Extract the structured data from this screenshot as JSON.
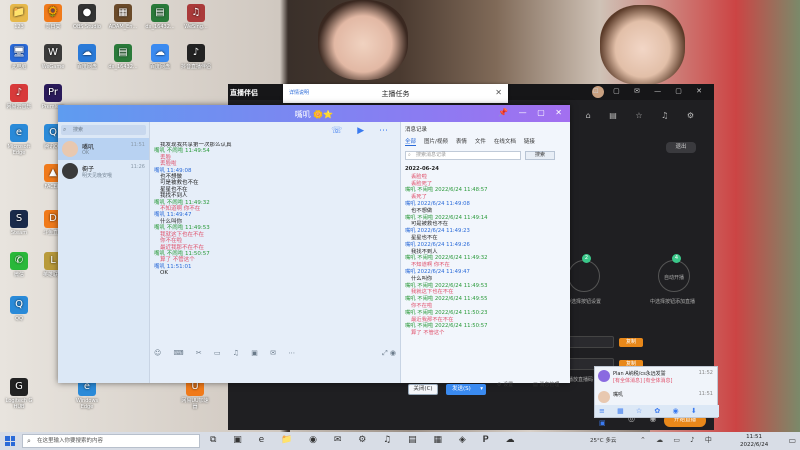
{
  "desktop": {
    "icons": [
      {
        "label": "123",
        "glyph": "📁",
        "color": "#e6b84a"
      },
      {
        "label": "向日葵",
        "glyph": "🌻",
        "color": "#f07a1a"
      },
      {
        "label": "OBS Studio",
        "glyph": "●",
        "color": "#333"
      },
      {
        "label": "ADAM_En...",
        "glyph": "▦",
        "color": "#6a4a2a"
      },
      {
        "label": "dx_16432...",
        "glyph": "▤",
        "color": "#2a7a3a"
      },
      {
        "label": "WeSing...",
        "glyph": "♫",
        "color": "#aa3a3a"
      },
      {
        "label": "此电脑",
        "glyph": "🖥",
        "color": "#2a6ad8"
      },
      {
        "label": "WeGame",
        "glyph": "W",
        "color": "#3a3a3a"
      },
      {
        "label": "百度网盘",
        "glyph": "☁",
        "color": "#2a7ad8"
      },
      {
        "label": "dx_16432...",
        "glyph": "▤",
        "color": "#2a7a3a"
      },
      {
        "label": "百度网盘",
        "glyph": "☁",
        "color": "#3a8af0"
      },
      {
        "label": "抖音直播伴侣",
        "glyph": "♪",
        "color": "#222"
      },
      {
        "label": "Premiere",
        "glyph": "Pr",
        "color": "#2a1a5a"
      },
      {
        "label": "网易云音乐",
        "glyph": "♪",
        "color": "#d83a3a"
      },
      {
        "label": "Microsoft Edge",
        "glyph": "e",
        "color": "#2a8ad8"
      },
      {
        "label": "腾讯QQ",
        "glyph": "Q",
        "color": "#2a8ad8"
      },
      {
        "label": "FACEIT",
        "glyph": "▲",
        "color": "#f07a1a"
      },
      {
        "label": "Steam",
        "glyph": "S",
        "color": "#1a2a4a"
      },
      {
        "label": "斗鱼直播",
        "glyph": "D",
        "color": "#f07a1a"
      },
      {
        "label": "微信",
        "glyph": "✆",
        "color": "#2ab83a"
      },
      {
        "label": "英雄联盟",
        "glyph": "L",
        "color": "#b89a3a"
      },
      {
        "label": "QQ",
        "glyph": "Q",
        "color": "#2a8ad8"
      },
      {
        "label": "Logitech G HUB",
        "glyph": "G",
        "color": "#222"
      },
      {
        "label": "Windows Edge",
        "glyph": "e",
        "color": "#2a8ad8"
      },
      {
        "label": "网易UU加速器",
        "glyph": "U",
        "color": "#f07a1a"
      }
    ]
  },
  "chat_window": {
    "title": "嘴叽 🌼⭐",
    "search_placeholder": "搜索",
    "contacts": [
      {
        "name": "嘴叽",
        "preview": "OK",
        "time": "11:51",
        "avatar_color": "#e8c8b0"
      },
      {
        "name": "橱子",
        "preview": "明天见晚安哦",
        "time": "11:26",
        "avatar_color": "#3a3a3a"
      }
    ],
    "messages": [
      {
        "kind": "t",
        "text": "我发现我共享第一次那么认真"
      },
      {
        "kind": "h-g",
        "text": "嘴叽 不闹啦 11:49:54"
      },
      {
        "kind": "t-r",
        "text": "丢脸"
      },
      {
        "kind": "t-r",
        "text": "丢脸啦"
      },
      {
        "kind": "h-b",
        "text": "嘴叽 11:49:08"
      },
      {
        "kind": "t",
        "text": "也不想做"
      },
      {
        "kind": "t",
        "text": "可是被救也不在"
      },
      {
        "kind": "t",
        "text": "星星也不在"
      },
      {
        "kind": "t",
        "text": "我找不到人"
      },
      {
        "kind": "h-g",
        "text": "嘴叽 不闹啦 11:49:32"
      },
      {
        "kind": "t-r",
        "text": "不知道啊 你不在"
      },
      {
        "kind": "h-b",
        "text": "嘴叽 11:49:47"
      },
      {
        "kind": "t",
        "text": "什么叫你"
      },
      {
        "kind": "h-g",
        "text": "嘴叽 不闹啦 11:49:53"
      },
      {
        "kind": "t-r",
        "text": "我就这下也在不在"
      },
      {
        "kind": "t-r",
        "text": "你不在啦"
      },
      {
        "kind": "t-r",
        "text": "最近我那不在不在"
      },
      {
        "kind": "h-g",
        "text": "嘴叽 不闹啦 11:50:57"
      },
      {
        "kind": "t-r",
        "text": "算了 不管这个"
      },
      {
        "kind": "h-b",
        "text": "嘴叽 11:51:01"
      },
      {
        "kind": "t",
        "text": "OK"
      }
    ],
    "toolbar_icons": "☺ ⌨ ✂ ▭ ♫ ▣ ✉ ⋯",
    "close_label": "关闭(C)",
    "send_label": "发送(S)",
    "record": {
      "title": "消息记录",
      "tabs": [
        "全部",
        "图片/视频",
        "表情",
        "文件",
        "在线文档",
        "链接"
      ],
      "search_placeholder": "搜索消息记录",
      "search_button": "搜索",
      "date": "2022-06-24",
      "messages": [
        {
          "kind": "t-r",
          "text": "丢脸啦"
        },
        {
          "kind": "t-r",
          "text": "丢脸死了"
        },
        {
          "kind": "h-g",
          "text": "嘴叽 不闹啦 2022/6/24 11:48:57"
        },
        {
          "kind": "t-r",
          "text": "丢死了"
        },
        {
          "kind": "h-b",
          "text": "嘴叽 2022/6/24 11:49:08"
        },
        {
          "kind": "t",
          "text": "也不想做"
        },
        {
          "kind": "h-g",
          "text": "嘴叽 不闹啦 2022/6/24 11:49:14"
        },
        {
          "kind": "t",
          "text": "可是被救也不在"
        },
        {
          "kind": "h-b",
          "text": "嘴叽 2022/6/24 11:49:23"
        },
        {
          "kind": "t",
          "text": "星星也不在"
        },
        {
          "kind": "h-b",
          "text": "嘴叽 2022/6/24 11:49:26"
        },
        {
          "kind": "t",
          "text": "我找不到人"
        },
        {
          "kind": "h-g",
          "text": "嘴叽 不闹啦 2022/6/24 11:49:32"
        },
        {
          "kind": "t-r",
          "text": "不知道啊 你不在"
        },
        {
          "kind": "h-b",
          "text": "嘴叽 2022/6/24 11:49:47"
        },
        {
          "kind": "t",
          "text": "什么叫你"
        },
        {
          "kind": "h-g",
          "text": "嘴叽 不闹啦 2022/6/24 11:49:53"
        },
        {
          "kind": "t-r",
          "text": "我就这下也在不在"
        },
        {
          "kind": "h-g",
          "text": "嘴叽 不闹啦 2022/6/24 11:49:55"
        },
        {
          "kind": "t-r",
          "text": "你不在啦"
        },
        {
          "kind": "h-g",
          "text": "嘴叽 不闹啦 2022/6/24 11:50:23"
        },
        {
          "kind": "t-r",
          "text": "最近我那不在不在"
        },
        {
          "kind": "h-g",
          "text": "嘴叽 不闹啦 2022/6/24 11:50:57"
        },
        {
          "kind": "t-r",
          "text": "算了 不管这个"
        }
      ],
      "footer_settings": "设置",
      "footer_manage": "消息管理"
    }
  },
  "task_window": {
    "help": "详情说明",
    "title": "主播任务"
  },
  "live_app": {
    "logo": "直播伴侣",
    "end_label": "退出",
    "circle1_label": "中选择按钮设置",
    "circle2_label": "自动开播",
    "circle2_sub": "中选择按钮添加直播",
    "strip_tag": "复制",
    "strip_caption": "播放直播码",
    "start_label": "开始直播",
    "badge1": "2",
    "badge2": "4"
  },
  "mini_chat": {
    "rows": [
      {
        "name": "Plan A纳税/cs永远发誓",
        "sub": "[有全体消息] [有全体消息]",
        "time": "11:52",
        "avatar_color": "#8a6ae0"
      },
      {
        "name": "嘴叽",
        "sub": "",
        "time": "11:51",
        "avatar_color": "#e8c8b0"
      }
    ],
    "icons": "≡ ▦ ☆ ✿ ◉ ⬇ ▣"
  },
  "taskbar": {
    "search_placeholder": "在这里输入你要搜索的内容",
    "apps": "⧉ ▣ e 📁 ◉ ✉ ⚙ ♫ ▤ ▦ ◈ 𝐏 ☁",
    "weather": "25°C 多云",
    "tray": "⌃ ☁ ▭ ♪ 中",
    "time": "11:51",
    "date": "2022/6/24"
  }
}
